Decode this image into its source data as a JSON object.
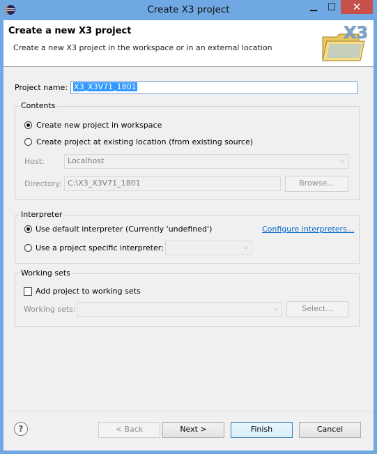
{
  "window": {
    "title": "Create X3 project",
    "minimize_glyph": "▁",
    "maximize_glyph": "□",
    "close_glyph": "✕"
  },
  "header": {
    "title": "Create a new X3 project",
    "description": "Create a new X3 project in the workspace or in an external location",
    "image_text": "X3"
  },
  "form": {
    "project_name_label": "Project name:",
    "project_name_value": "X3_X3V71_1801"
  },
  "contents": {
    "title": "Contents",
    "radio_new": "Create new project in workspace",
    "radio_existing": "Create project at existing location (from existing source)",
    "host_label": "Host:",
    "host_value": "Localhost",
    "directory_label": "Directory:",
    "directory_value": "C:\\X3_X3V71_1801",
    "browse_label": "Browse..."
  },
  "interpreter": {
    "title": "Interpreter",
    "radio_default": "Use default interpreter (Currently 'undefined')",
    "configure_link": "Configure interpreters...",
    "radio_specific": "Use a project specific interpreter:",
    "specific_value": ""
  },
  "working_sets": {
    "title": "Working sets",
    "checkbox_label": "Add project to working sets",
    "sets_label": "Working sets:",
    "sets_value": "",
    "select_label": "Select..."
  },
  "footer": {
    "help_glyph": "?",
    "back_label": "< Back",
    "next_label": "Next >",
    "finish_label": "Finish",
    "cancel_label": "Cancel"
  },
  "colors": {
    "titlebar": "#6fa8e3",
    "close": "#c7504a",
    "selection": "#3399ff",
    "link": "#0066cc"
  }
}
